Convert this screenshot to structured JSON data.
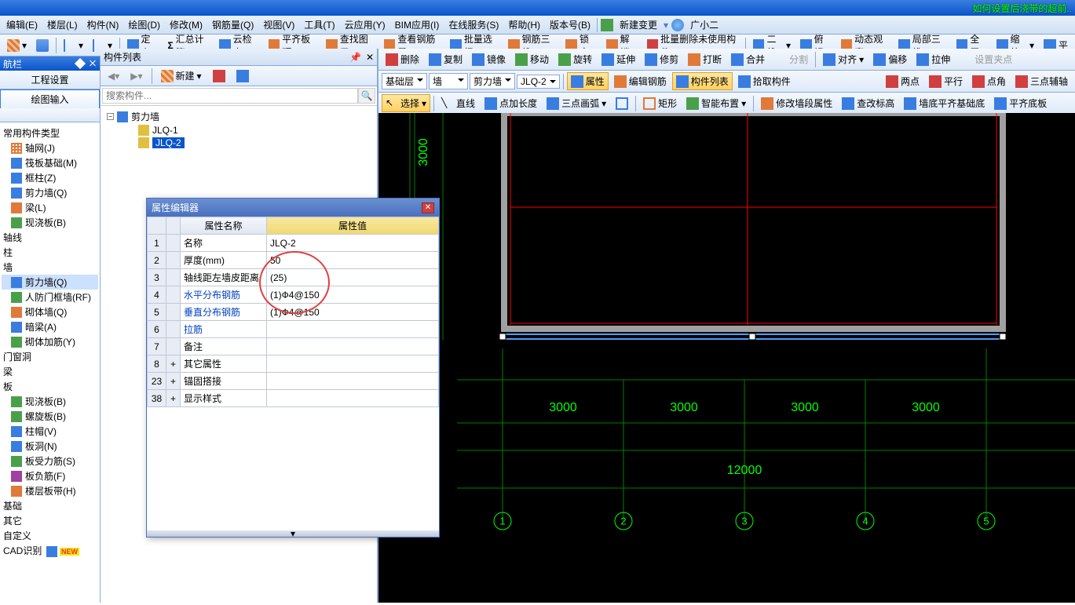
{
  "help_link": "如何设置后浇带的超前..",
  "menu": [
    "编辑(E)",
    "楼层(L)",
    "构件(N)",
    "绘图(D)",
    "修改(M)",
    "钢筋量(Q)",
    "视图(V)",
    "工具(T)",
    "云应用(Y)",
    "BIM应用(I)",
    "在线服务(S)",
    "帮助(H)",
    "版本号(B)"
  ],
  "menu_extra": [
    "新建变更",
    "广小二"
  ],
  "toolbar1": {
    "def": "定义",
    "sum_calc": "汇总计算",
    "cloud": "云检查",
    "flat_top": "平齐板顶",
    "find": "查找图元",
    "find_rebar": "查看钢筋量",
    "batch_sel": "批量选择",
    "rebar3d": "钢筋三维",
    "lock": "锁定",
    "unlock": "解锁",
    "batch_del": "批量删除未使用构件",
    "two_d": "二维",
    "persp": "俯视",
    "dyn_obs": "动态观察",
    "local3d": "局部三维",
    "full": "全屏",
    "zoom": "缩放",
    "pan": "平"
  },
  "toolbar2": {
    "del": "删除",
    "copy": "复制",
    "mirror": "镜像",
    "move": "移动",
    "rotate": "旋转",
    "extend": "延伸",
    "trim": "修剪",
    "break": "打断",
    "merge": "合并",
    "split": "分割",
    "align": "对齐",
    "offset": "偏移",
    "stretch": "拉伸",
    "set_grip": "设置夹点"
  },
  "toolbar3": {
    "floor_dd": "基础层",
    "cat_dd": "墙",
    "type_dd": "剪力墙",
    "comp_dd": "JLQ-2",
    "prop": "属性",
    "edit_rebar": "编辑钢筋",
    "comp_list": "构件列表",
    "pick": "拾取构件",
    "two_pt": "两点",
    "parallel": "平行",
    "pt_angle": "点角",
    "three_pt": "三点辅轴"
  },
  "toolbar4": {
    "select": "选择",
    "line": "直线",
    "pt_len": "点加长度",
    "arc3": "三点画弧",
    "rect": "矩形",
    "smart": "智能布置",
    "mod_wall": "修改墙段属性",
    "check_elev": "查改标高",
    "base_flat": "墙底平齐基础底",
    "flat_bot": "平齐底板"
  },
  "nav": {
    "title": "航栏",
    "tabs": [
      "工程设置",
      "绘图输入"
    ],
    "group_common": "常用构件类型",
    "items_a": [
      "轴网(J)",
      "筏板基础(M)",
      "框柱(Z)",
      "剪力墙(Q)",
      "梁(L)",
      "现浇板(B)"
    ],
    "groups_b": [
      "轴线",
      "柱",
      "墙"
    ],
    "items_wall": [
      "剪力墙(Q)",
      "人防门框墙(RF)",
      "砌体墙(Q)",
      "暗梁(A)",
      "砌体加筋(Y)"
    ],
    "groups_c": [
      "门窗洞",
      "梁",
      "板"
    ],
    "items_slab": [
      "现浇板(B)",
      "螺旋板(B)",
      "柱帽(V)",
      "板洞(N)",
      "板受力筋(S)",
      "板负筋(F)",
      "楼层板带(H)"
    ],
    "groups_d": [
      "基础",
      "其它",
      "自定义",
      "CAD识别"
    ],
    "new_badge": "NEW"
  },
  "comp": {
    "title": "构件列表",
    "new": "新建",
    "search_ph": "搜索构件...",
    "root": "剪力墙",
    "items": [
      "JLQ-1",
      "JLQ-2"
    ]
  },
  "prop": {
    "title": "属性编辑器",
    "col_name": "属性名称",
    "col_val": "属性值",
    "rows": [
      {
        "n": "1",
        "name": "名称",
        "val": "JLQ-2"
      },
      {
        "n": "2",
        "name": "厚度(mm)",
        "val": "50"
      },
      {
        "n": "3",
        "name": "轴线距左墙皮距离",
        "val": "(25)"
      },
      {
        "n": "4",
        "name": "水平分布钢筋",
        "val": "(1)Ф4@150",
        "blue": true
      },
      {
        "n": "5",
        "name": "垂直分布钢筋",
        "val": "(1)Ф4@150",
        "blue": true
      },
      {
        "n": "6",
        "name": "拉筋",
        "val": "",
        "blue": true
      },
      {
        "n": "7",
        "name": "备注",
        "val": ""
      },
      {
        "n": "8",
        "name": "其它属性",
        "val": "",
        "exp": "+"
      },
      {
        "n": "23",
        "name": "锚固搭接",
        "val": "",
        "exp": "+"
      },
      {
        "n": "38",
        "name": "显示样式",
        "val": "",
        "exp": "+"
      }
    ]
  },
  "drawing": {
    "dim_v": "3000",
    "dims_h": [
      "3000",
      "3000",
      "3000",
      "3000"
    ],
    "dim_total": "12000",
    "axes": [
      "1",
      "2",
      "3",
      "4",
      "5"
    ]
  }
}
